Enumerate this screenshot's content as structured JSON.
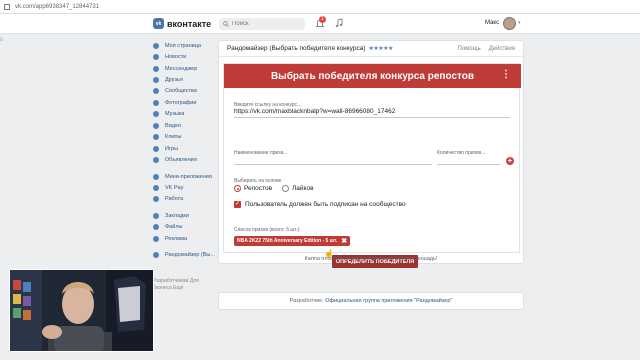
{
  "browser": {
    "url": "vk.com/app6938347_12844731"
  },
  "header": {
    "logo_text": "вконтакте",
    "search_placeholder": "Поиск",
    "notifications_count": "1",
    "user_name": "Макс"
  },
  "left_cut_text": "s",
  "sidebar": {
    "items": [
      {
        "label": "Моя страница",
        "icon": "home-icon"
      },
      {
        "label": "Новости",
        "icon": "news-icon"
      },
      {
        "label": "Мессенджер",
        "icon": "messenger-icon"
      },
      {
        "label": "Друзья",
        "icon": "friends-icon"
      },
      {
        "label": "Сообщества",
        "icon": "communities-icon"
      },
      {
        "label": "Фотографии",
        "icon": "photos-icon"
      },
      {
        "label": "Музыка",
        "icon": "music-icon"
      },
      {
        "label": "Видео",
        "icon": "video-icon"
      },
      {
        "label": "Клипы",
        "icon": "clips-icon"
      },
      {
        "label": "Игры",
        "icon": "games-icon"
      },
      {
        "label": "Объявления",
        "icon": "ads-icon"
      }
    ],
    "items2": [
      {
        "label": "Мини-приложения",
        "icon": "apps-icon"
      },
      {
        "label": "VK Pay",
        "icon": "vkpay-icon"
      },
      {
        "label": "Работа",
        "icon": "work-icon"
      }
    ],
    "items3": [
      {
        "label": "Закладки",
        "icon": "bookmark-icon"
      },
      {
        "label": "Файлы",
        "icon": "files-icon"
      },
      {
        "label": "Реклама",
        "icon": "ads-megaphone-icon"
      }
    ],
    "items4": [
      {
        "label": "Рандомайзер (Вы...",
        "icon": "randomizer-app-icon"
      }
    ],
    "footer": "Разработчикам  Для бизнеса  Ещё"
  },
  "app": {
    "title": "Рандомайзер (Выбрать победителя конкурса)",
    "stars": "★★★★★",
    "help": "Помощь",
    "actions": "Действия"
  },
  "form": {
    "banner_title": "Выбрать победителя конкурса репостов",
    "link_label": "Введите ссылку на конкурс...",
    "link_value": "https://vk.com/maxblacknbalp?w=wall-86966080_17462",
    "prize_name_label": "Наименование приза...",
    "prize_count_label": "Количество призов...",
    "choose_label": "Выбирать на основе",
    "option_reposts": "Репостов",
    "option_likes": "Лайков",
    "subscribed_label": "Пользователь должен быть подписан на сообщество",
    "prize_list_label": "Список призов (всего: 5 шт.):",
    "prize_chip": "NBA 2K22 75th Anniversary Edition - 5 шт.",
    "winner_button": "ОПРЕДЕЛИТЬ ПОБЕДИТЕЛЯ"
  },
  "promo_text": "Каппа плохой оценки приложению убивает лошадь!",
  "developer": {
    "prefix": "Разработчик:",
    "link": "Официальная группа приложения \"Рандомайзер\""
  },
  "colors": {
    "accent": "#be3b38",
    "vk_blue": "#4a76a8",
    "link": "#2a5885"
  }
}
